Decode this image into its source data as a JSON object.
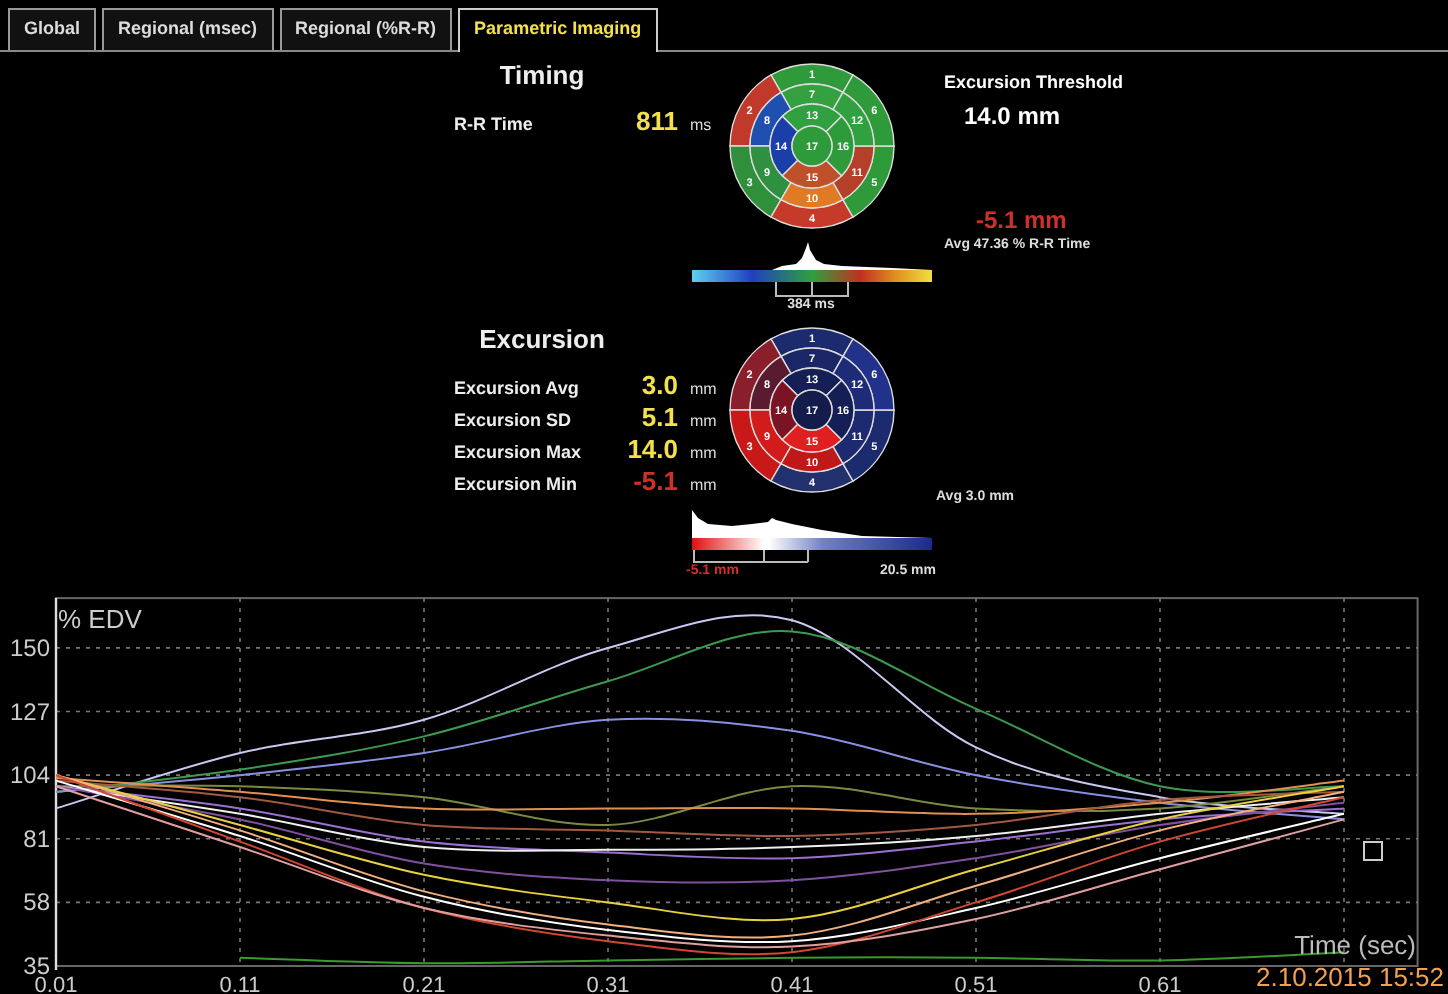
{
  "tabs": [
    {
      "label": "Global",
      "selected": false
    },
    {
      "label": "Regional (msec)",
      "selected": false
    },
    {
      "label": "Regional (%R-R)",
      "selected": false
    },
    {
      "label": "Parametric Imaging",
      "selected": true
    }
  ],
  "timing": {
    "title": "Timing",
    "rows": [
      {
        "label": "R-R Time",
        "value": "811",
        "unit": "ms",
        "color": "#f2e14c"
      }
    ],
    "segments": [
      {
        "label": "1",
        "color": "#2f9a3a"
      },
      {
        "label": "2",
        "color": "#c0392b"
      },
      {
        "label": "3",
        "color": "#2f8f3a"
      },
      {
        "label": "4",
        "color": "#c63a2a"
      },
      {
        "label": "5",
        "color": "#2f9a3a"
      },
      {
        "label": "6",
        "color": "#2f9a3a"
      },
      {
        "label": "7",
        "color": "#35a040"
      },
      {
        "label": "8",
        "color": "#1f4fb0"
      },
      {
        "label": "9",
        "color": "#2f9040"
      },
      {
        "label": "10",
        "color": "#e07a24"
      },
      {
        "label": "11",
        "color": "#b5402a"
      },
      {
        "label": "12",
        "color": "#30a040"
      },
      {
        "label": "13",
        "color": "#30a040"
      },
      {
        "label": "14",
        "color": "#1b3fa8"
      },
      {
        "label": "15",
        "color": "#c0502a"
      },
      {
        "label": "16",
        "color": "#2f9a3a"
      }
    ],
    "apex": {
      "label": "17",
      "color": "#2f9a3a"
    },
    "scale_label": "384 ms"
  },
  "threshold": {
    "title": "Excursion Threshold",
    "value": "14.0 mm",
    "minimum": "-5.1 mm",
    "average": "Avg 47.36 % R-R Time"
  },
  "excursion": {
    "title": "Excursion",
    "rows": [
      {
        "label": "Excursion Avg",
        "value": "3.0",
        "unit": "mm",
        "color": "#f2e14c"
      },
      {
        "label": "Excursion SD",
        "value": "5.1",
        "unit": "mm",
        "color": "#f2e14c"
      },
      {
        "label": "Excursion Max",
        "value": "14.0",
        "unit": "mm",
        "color": "#f2e14c"
      },
      {
        "label": "Excursion Min",
        "value": "-5.1",
        "unit": "mm",
        "color": "#d0302a"
      }
    ],
    "segments": [
      {
        "label": "1",
        "color": "#1c2a6e"
      },
      {
        "label": "2",
        "color": "#8a1e2a"
      },
      {
        "label": "3",
        "color": "#c81818"
      },
      {
        "label": "4",
        "color": "#23306e"
      },
      {
        "label": "5",
        "color": "#1c2a6e"
      },
      {
        "label": "6",
        "color": "#22318a"
      },
      {
        "label": "7",
        "color": "#1a2666"
      },
      {
        "label": "8",
        "color": "#5a1a30"
      },
      {
        "label": "9",
        "color": "#d21c1c"
      },
      {
        "label": "10",
        "color": "#c01818"
      },
      {
        "label": "11",
        "color": "#1e2a70"
      },
      {
        "label": "12",
        "color": "#1e2c78"
      },
      {
        "label": "13",
        "color": "#151f55"
      },
      {
        "label": "14",
        "color": "#7a1424"
      },
      {
        "label": "15",
        "color": "#e02020"
      },
      {
        "label": "16",
        "color": "#151f55"
      }
    ],
    "apex": {
      "label": "17",
      "color": "#141c4c"
    },
    "scale_min": "-5.1 mm",
    "scale_max": "20.5 mm",
    "average": "Avg 3.0 mm"
  },
  "chart": {
    "date_stamp": "2.10.2015 15:52",
    "chart_data": {
      "type": "line",
      "xlabel": "Time (sec)",
      "ylabel": "% EDV",
      "x": [
        0.01,
        0.11,
        0.21,
        0.31,
        0.41,
        0.51,
        0.61,
        0.71
      ],
      "xlim": [
        0.01,
        0.75
      ],
      "ylim": [
        35,
        168
      ],
      "xticks": [
        0.01,
        0.11,
        0.21,
        0.31,
        0.41,
        0.51,
        0.61
      ],
      "yticks": [
        35,
        58,
        81,
        104,
        127,
        150
      ],
      "grid": true,
      "series": [
        {
          "color": "#c8c8f0",
          "values": [
            92,
            112,
            124,
            150,
            160,
            114,
            96,
            90
          ]
        },
        {
          "color": "#3c9a50",
          "values": [
            98,
            106,
            118,
            138,
            156,
            128,
            100,
            100
          ]
        },
        {
          "color": "#8a90e0",
          "values": [
            98,
            104,
            112,
            124,
            120,
            104,
            94,
            88
          ]
        },
        {
          "color": "#7a8a40",
          "values": [
            100,
            100,
            96,
            86,
            100,
            92,
            92,
            100
          ]
        },
        {
          "color": "#e09050",
          "values": [
            103,
            98,
            92,
            92,
            92,
            90,
            94,
            102
          ]
        },
        {
          "color": "#a05a40",
          "values": [
            102,
            96,
            86,
            84,
            82,
            86,
            95,
            98
          ]
        },
        {
          "color": "#9a70d0",
          "values": [
            100,
            92,
            80,
            76,
            74,
            80,
            88,
            92
          ]
        },
        {
          "color": "#f0f0f0",
          "values": [
            100,
            90,
            78,
            77,
            78,
            82,
            90,
            96
          ]
        },
        {
          "color": "#8050a0",
          "values": [
            100,
            88,
            72,
            66,
            66,
            74,
            86,
            94
          ]
        },
        {
          "color": "#e8d040",
          "values": [
            104,
            86,
            68,
            58,
            52,
            70,
            88,
            100
          ]
        },
        {
          "color": "#f0b080",
          "values": [
            104,
            84,
            62,
            50,
            46,
            64,
            84,
            98
          ]
        },
        {
          "color": "#ffffff",
          "values": [
            102,
            82,
            60,
            48,
            44,
            56,
            74,
            90
          ]
        },
        {
          "color": "#d04830",
          "values": [
            104,
            80,
            56,
            44,
            40,
            58,
            80,
            96
          ]
        },
        {
          "color": "#e0a0a0",
          "values": [
            100,
            78,
            56,
            46,
            42,
            52,
            70,
            88
          ]
        },
        {
          "color": "#3a9a30",
          "values": [
            null,
            38,
            36,
            37,
            38,
            38,
            37,
            40
          ]
        }
      ]
    }
  }
}
